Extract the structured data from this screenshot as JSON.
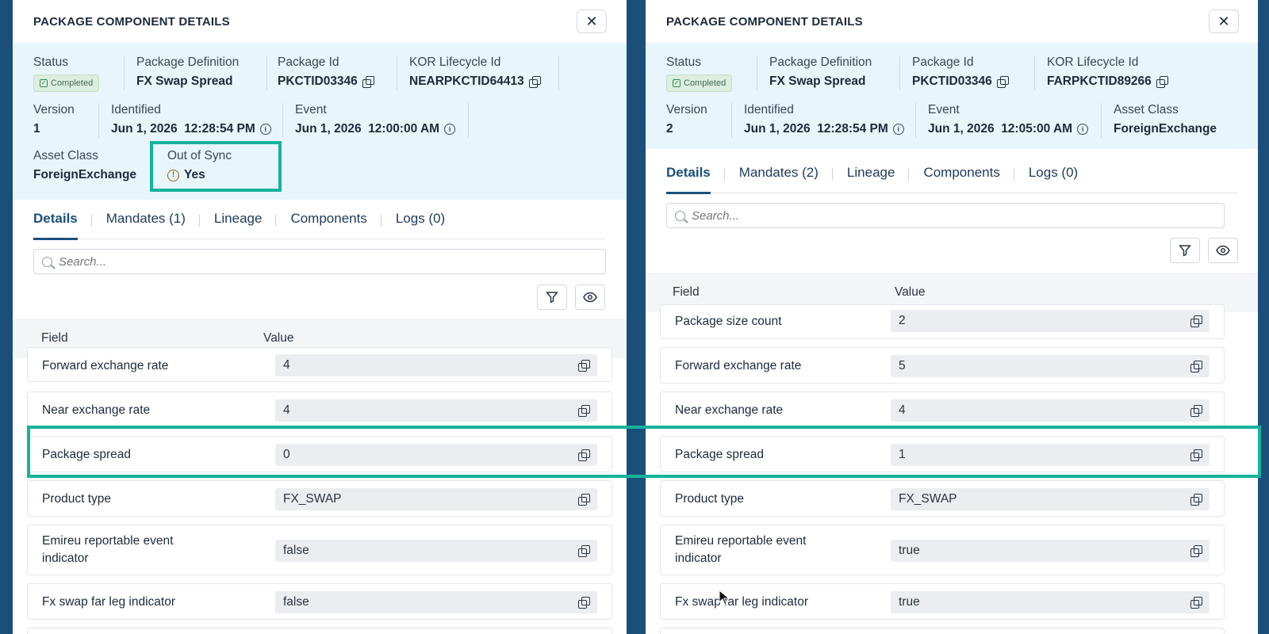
{
  "panels": [
    {
      "title": "PACKAGE COMPONENT DETAILS",
      "close_label": "✕",
      "status": {
        "label": "Status",
        "value": "Completed"
      },
      "package_definition": {
        "label": "Package Definition",
        "value": "FX Swap Spread"
      },
      "package_id": {
        "label": "Package Id",
        "value": "PKCTID03346"
      },
      "kor_lifecycle_id": {
        "label": "KOR Lifecycle Id",
        "value": "NEARPKCTID64413"
      },
      "version": {
        "label": "Version",
        "value": "1"
      },
      "identified": {
        "label": "Identified",
        "value": "Jun 1, 2026  12:28:54 PM"
      },
      "event": {
        "label": "Event",
        "value": "Jun 1, 2026  12:00:00 AM"
      },
      "asset_class": {
        "label": "Asset Class",
        "value": "ForeignExchange"
      },
      "out_of_sync": {
        "label": "Out of Sync",
        "value": "Yes"
      },
      "tabs": [
        "Details",
        "Mandates (1)",
        "Lineage",
        "Components",
        "Logs (0)"
      ],
      "search_placeholder": "Search...",
      "columns": {
        "field": "Field",
        "value": "Value"
      },
      "rows": [
        {
          "field": "Forward exchange rate",
          "value": "4"
        },
        {
          "field": "Near exchange rate",
          "value": "4"
        },
        {
          "field": "Package spread",
          "value": "0"
        },
        {
          "field": "Product type",
          "value": "FX_SWAP"
        },
        {
          "field": "Emireu reportable event indicator",
          "value": "false"
        },
        {
          "field": "Fx swap far leg indicator",
          "value": "false"
        }
      ]
    },
    {
      "title": "PACKAGE COMPONENT DETAILS",
      "close_label": "✕",
      "status": {
        "label": "Status",
        "value": "Completed"
      },
      "package_definition": {
        "label": "Package Definition",
        "value": "FX Swap Spread"
      },
      "package_id": {
        "label": "Package Id",
        "value": "PKCTID03346"
      },
      "kor_lifecycle_id": {
        "label": "KOR Lifecycle Id",
        "value": "FARPKCTID89266"
      },
      "version": {
        "label": "Version",
        "value": "2"
      },
      "identified": {
        "label": "Identified",
        "value": "Jun 1, 2026  12:28:54 PM"
      },
      "event": {
        "label": "Event",
        "value": "Jun 1, 2026  12:05:00 AM"
      },
      "asset_class": {
        "label": "Asset Class",
        "value": "ForeignExchange"
      },
      "tabs": [
        "Details",
        "Mandates (2)",
        "Lineage",
        "Components",
        "Logs (0)"
      ],
      "search_placeholder": "Search...",
      "columns": {
        "field": "Field",
        "value": "Value"
      },
      "rows": [
        {
          "field": "Package size count",
          "value": "2"
        },
        {
          "field": "Forward exchange rate",
          "value": "5"
        },
        {
          "field": "Near exchange rate",
          "value": "4"
        },
        {
          "field": "Package spread",
          "value": "1"
        },
        {
          "field": "Product type",
          "value": "FX_SWAP"
        },
        {
          "field": "Emireu reportable event indicator",
          "value": "true"
        },
        {
          "field": "Fx swap far leg indicator",
          "value": "true"
        }
      ]
    }
  ],
  "colors": {
    "accent": "#1b4f7a",
    "highlight": "#16b29b",
    "meta_bg": "#e8f5fb",
    "warning": "#8a6a10"
  }
}
